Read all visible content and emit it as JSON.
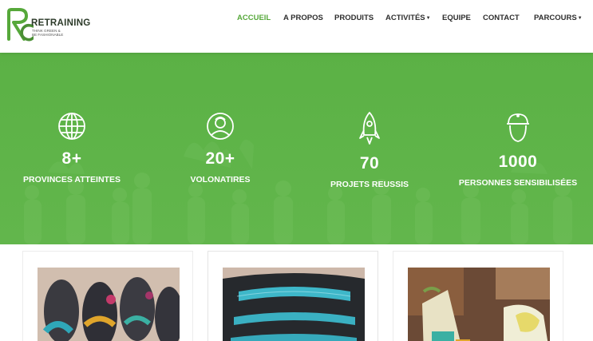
{
  "brand": {
    "name": "RETRAINING",
    "tagline_line1": "THINK GREEN &",
    "tagline_line2": "BE FASHIONABLE",
    "logo_letters": "RC"
  },
  "nav": {
    "items": [
      {
        "label": "ACCUEIL",
        "active": true
      },
      {
        "label": "A PROPOS"
      },
      {
        "label": "PRODUITS"
      },
      {
        "label": "ACTIVITÉS",
        "dropdown": true
      },
      {
        "label": "EQUIPE"
      },
      {
        "label": "CONTACT"
      },
      {
        "label": "PARCOURS",
        "dropdown": true
      }
    ]
  },
  "stats": [
    {
      "icon": "globe-icon",
      "value": "8+",
      "label": "PROVINCES ATTEINTES"
    },
    {
      "icon": "volunteer-icon",
      "value": "20+",
      "label": "VOLONATIRES"
    },
    {
      "icon": "rocket-icon",
      "value": "70",
      "label": "PROJETS REUSSIS"
    },
    {
      "icon": "cap-person-icon",
      "value": "1000",
      "label": "PERSONNES SENSIBILISÉES"
    }
  ],
  "cards": [
    {
      "image": "sandals-photo"
    },
    {
      "image": "bag-photo"
    },
    {
      "image": "workshop-photo"
    }
  ],
  "colors": {
    "accent": "#56a83a",
    "hero_green": "#5cb146",
    "text_dark": "#2e2e2e"
  }
}
